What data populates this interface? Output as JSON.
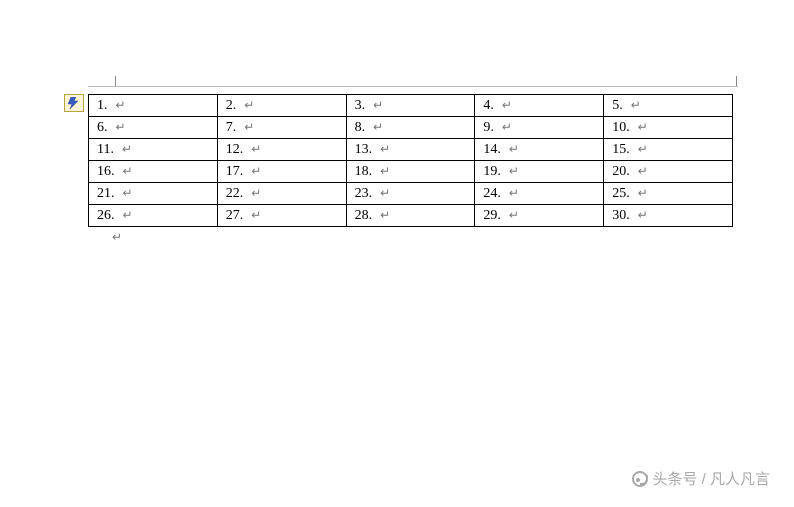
{
  "table": {
    "rows": 6,
    "cols": 5,
    "cells": [
      [
        "1.",
        "2.",
        "3.",
        "4.",
        "5."
      ],
      [
        "6.",
        "7.",
        "8.",
        "9.",
        "10."
      ],
      [
        "11.",
        "12.",
        "13.",
        "14.",
        "15."
      ],
      [
        "16.",
        "17.",
        "18.",
        "19.",
        "20."
      ],
      [
        "21.",
        "22.",
        "23.",
        "24.",
        "25."
      ],
      [
        "26.",
        "27.",
        "28.",
        "29.",
        "30."
      ]
    ],
    "paragraph_mark": "↵"
  },
  "trailing_mark": "↵",
  "watermark": {
    "text": "头条号 / 凡人凡言"
  }
}
